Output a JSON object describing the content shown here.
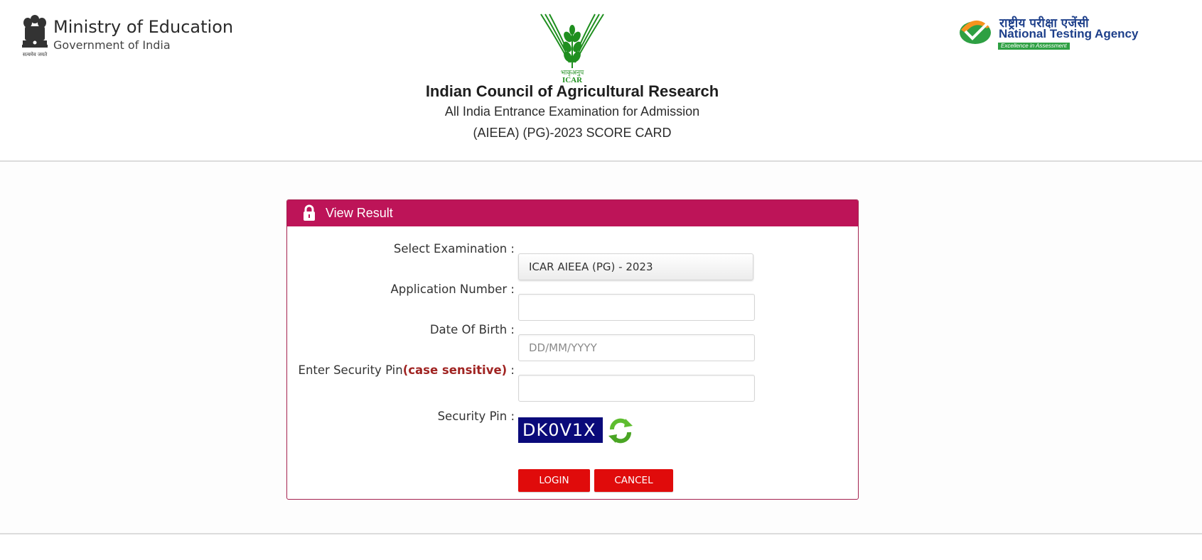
{
  "header": {
    "ministry": {
      "title": "Ministry of Education",
      "subtitle": "Government of India",
      "emblem_motto": "सत्यमेव जयते"
    },
    "icar": {
      "logo_text_hindi": "भाकृअनुप",
      "logo_text": "ICAR",
      "title": "Indian Council of Agricultural Research",
      "subtitle_line1": "All India Entrance Examination for Admission",
      "subtitle_line2": "(AIEEA) (PG)-2023 SCORE CARD"
    },
    "nta": {
      "hindi": "राष्ट्रीय परीक्षा एजेंसी",
      "english": "National Testing Agency",
      "tagline": "Excellence in Assessment"
    }
  },
  "panel": {
    "title": "View Result",
    "icon": "lock-icon",
    "fields": {
      "exam_label": "Select Examination :",
      "exam_value": "ICAR AIEEA (PG) - 2023",
      "app_label": "Application Number :",
      "app_value": "",
      "dob_label": "Date Of Birth :",
      "dob_placeholder": "DD/MM/YYYY",
      "pin_label_prefix": "Enter Security Pin",
      "pin_label_case": "(case sensitive)",
      "pin_label_suffix": " :",
      "pin_value": "",
      "captcha_label": "Security Pin :",
      "captcha_value": "DK0V1X"
    },
    "buttons": {
      "login": "LOGIN",
      "cancel": "CANCEL"
    }
  },
  "colors": {
    "panel_header": "#bd1458",
    "button": "#e00b0b",
    "captcha_bg": "#0a0a7a",
    "icar_green": "#1f8f1f"
  }
}
